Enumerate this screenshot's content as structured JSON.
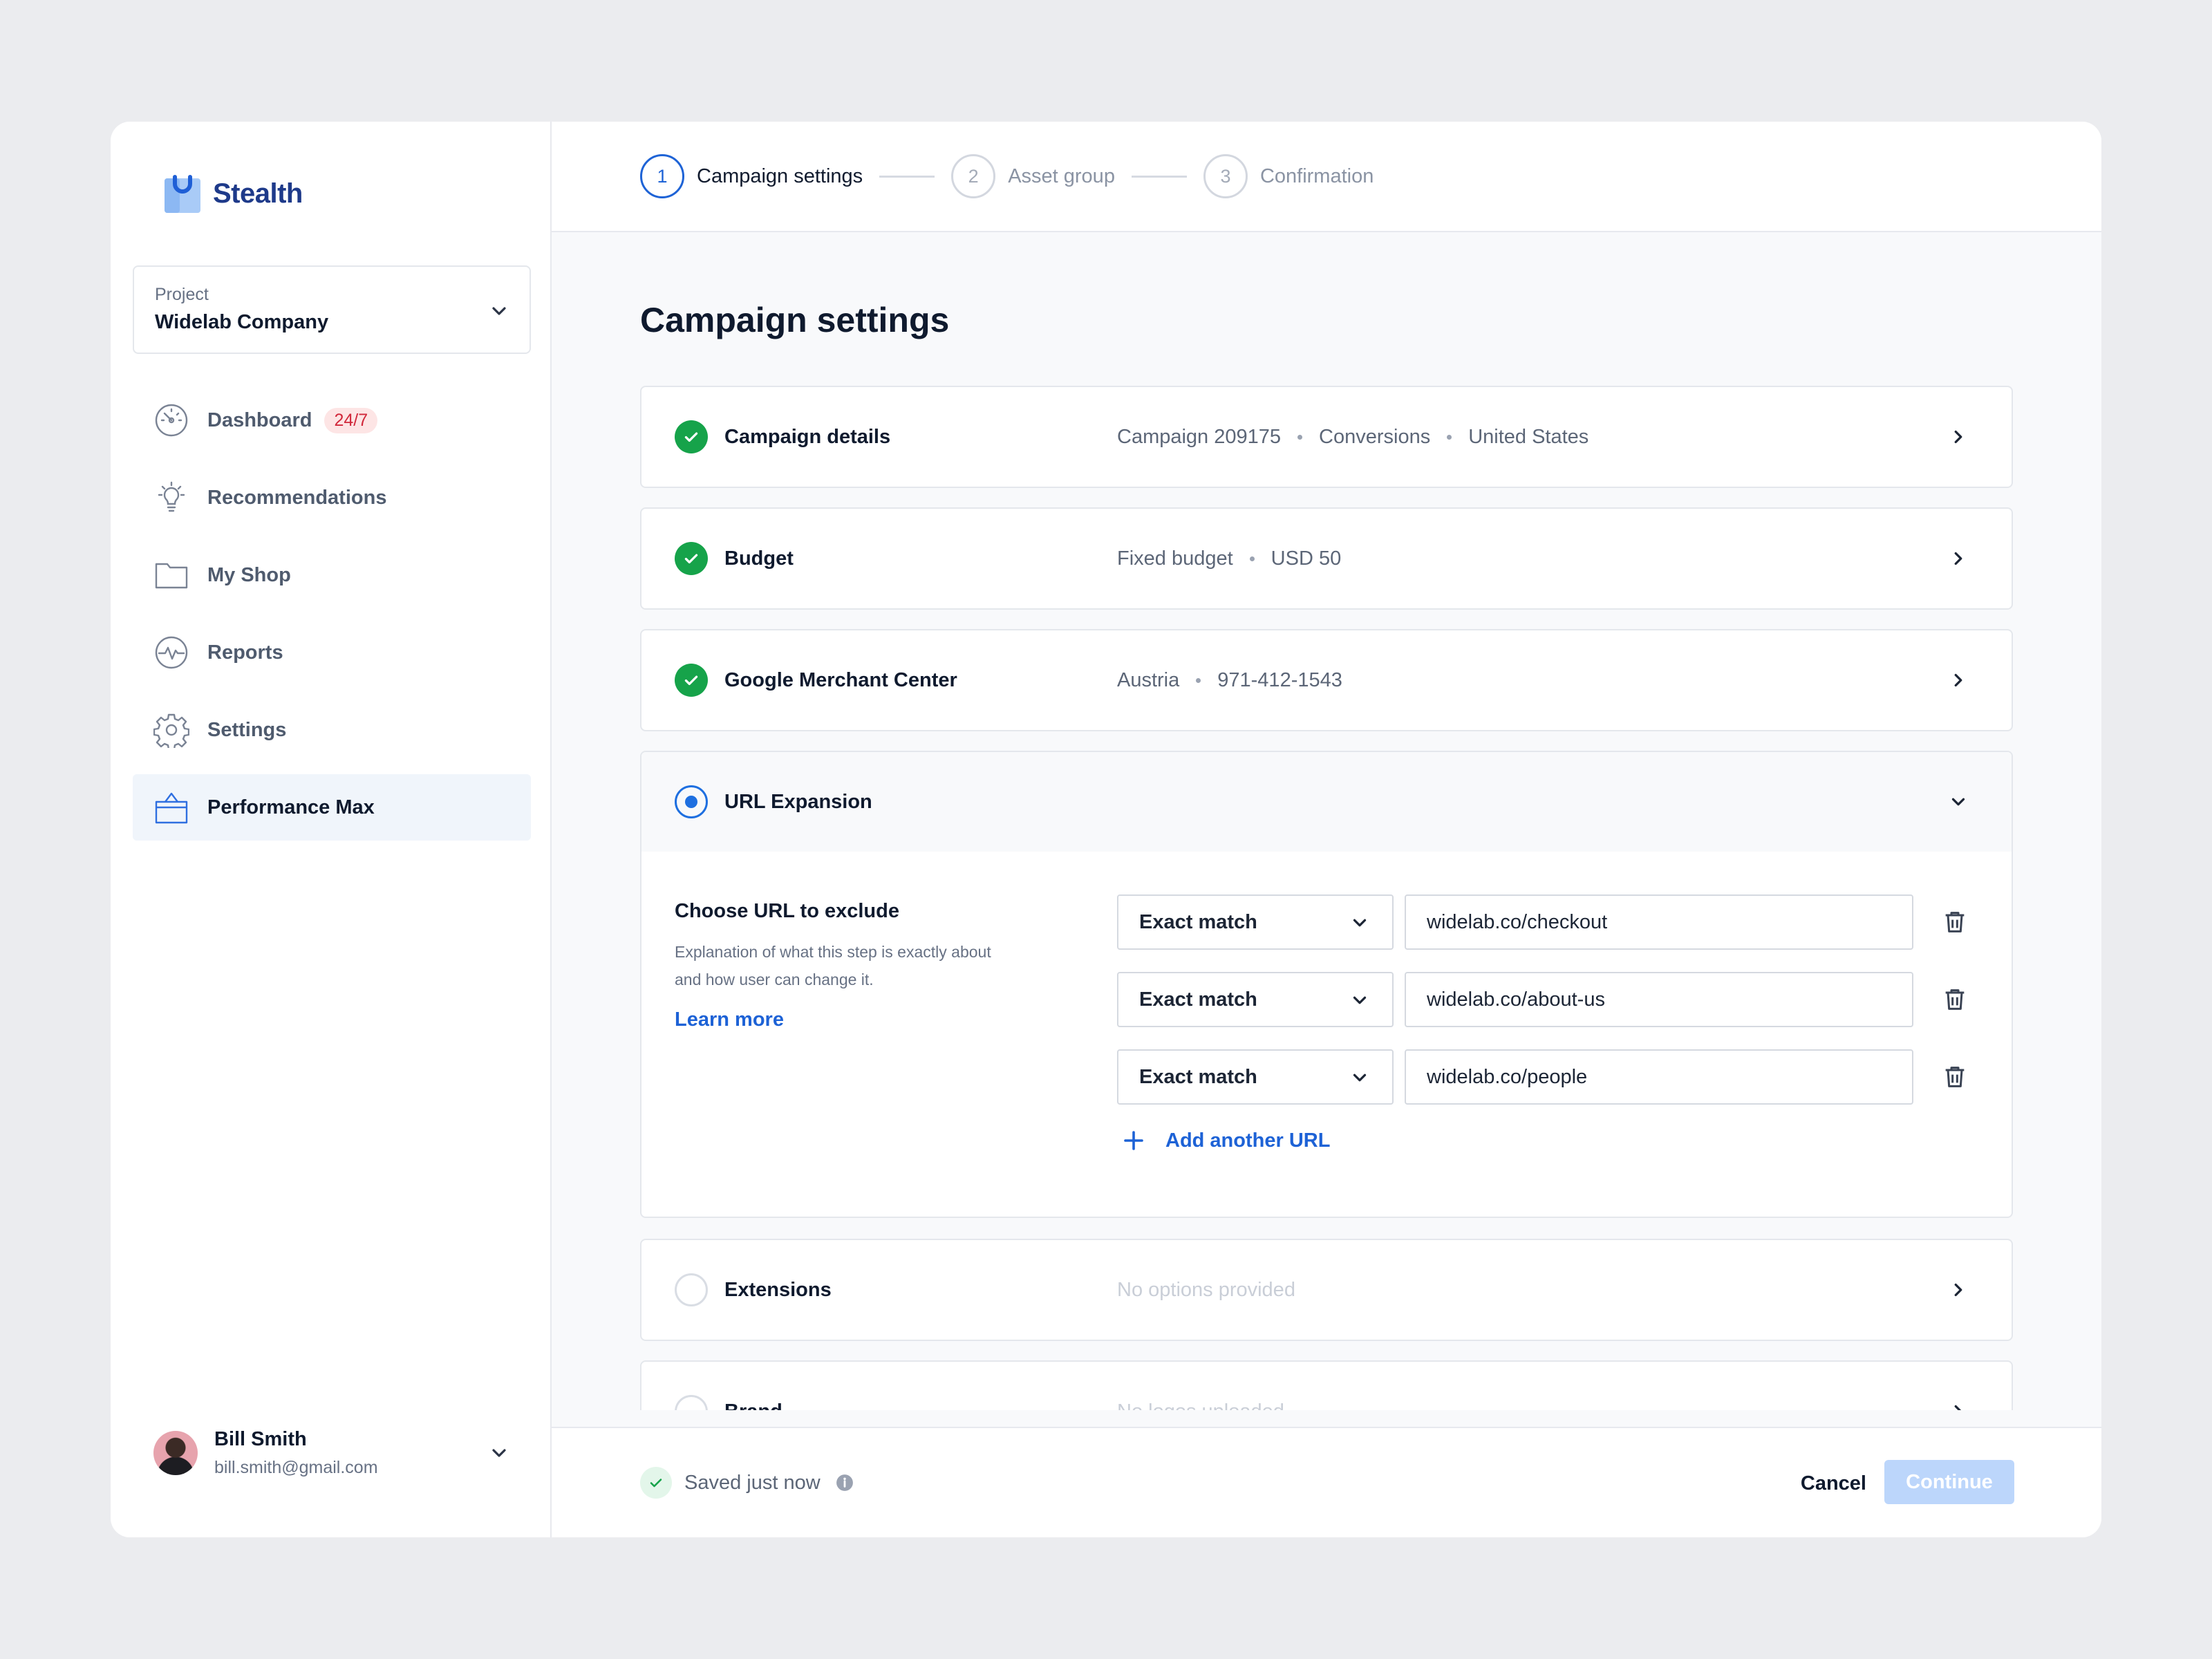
{
  "app": {
    "name": "Stealth"
  },
  "project": {
    "label": "Project",
    "value": "Widelab Company"
  },
  "nav": [
    {
      "label": "Dashboard",
      "icon": "gauge-icon",
      "badge": "24/7"
    },
    {
      "label": "Recommendations",
      "icon": "lightbulb-icon"
    },
    {
      "label": "My Shop",
      "icon": "folder-icon"
    },
    {
      "label": "Reports",
      "icon": "activity-icon"
    },
    {
      "label": "Settings",
      "icon": "gear-icon"
    },
    {
      "label": "Performance Max",
      "icon": "shopping-bag-icon",
      "active": true
    }
  ],
  "user": {
    "name": "Bill Smith",
    "email": "bill.smith@gmail.com"
  },
  "stepper": [
    {
      "number": "1",
      "label": "Campaign settings",
      "active": true
    },
    {
      "number": "2",
      "label": "Asset group"
    },
    {
      "number": "3",
      "label": "Confirmation"
    }
  ],
  "page": {
    "title": "Campaign settings"
  },
  "sections": {
    "campaign_details": {
      "title": "Campaign details",
      "summary": [
        "Campaign 209175",
        "Conversions",
        "United States"
      ],
      "status": "complete"
    },
    "budget": {
      "title": "Budget",
      "summary": [
        "Fixed budget",
        "USD 50"
      ],
      "status": "complete"
    },
    "merchant": {
      "title": "Google Merchant Center",
      "summary": [
        "Austria",
        "971-412-1543"
      ],
      "status": "complete"
    },
    "url_expansion": {
      "title": "URL Expansion",
      "status": "in-progress",
      "heading": "Choose URL to exclude",
      "description": "Explanation of what this step is exactly about and how user can change it.",
      "learn_more": "Learn more",
      "rules": [
        {
          "match": "Exact match",
          "url": "widelab.co/checkout"
        },
        {
          "match": "Exact match",
          "url": "widelab.co/about-us"
        },
        {
          "match": "Exact match",
          "url": "widelab.co/people"
        }
      ],
      "add_label": "Add another URL"
    },
    "extensions": {
      "title": "Extensions",
      "summary": "No options provided",
      "status": "empty"
    },
    "brand": {
      "title": "Brand",
      "summary": "No logos uploaded",
      "status": "empty"
    }
  },
  "footer": {
    "saved_text": "Saved just now",
    "cancel": "Cancel",
    "continue": "Continue"
  },
  "colors": {
    "accent": "#1e63d6",
    "success": "#16a34a",
    "badge_bg": "#fde5e5",
    "badge_text": "#d1283b",
    "continue_disabled": "#bcd6fb"
  }
}
